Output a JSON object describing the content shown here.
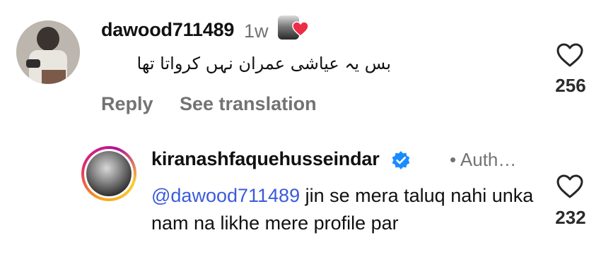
{
  "comment": {
    "username": "dawood711489",
    "time": "1w",
    "text": "بس یہ عیاشی عمران نہں کرواتا تھا",
    "reply_label": "Reply",
    "see_translation_label": "See translation",
    "like_count": "256",
    "avatar_icon": "profile-photo",
    "liked_by_author_icon": "heart-icon"
  },
  "reply": {
    "username": "kiranashfaquehusseindar",
    "verified": true,
    "author_label": "• Auth…",
    "mention": "@dawood711489",
    "text": " jin se mera taluq nahi unka nam na likhe mere profile par",
    "like_count": "232",
    "accent_color": "#3b5bdb"
  },
  "colors": {
    "like_heart_outline": "#262626",
    "liked_heart": "#ed2d45",
    "verified_badge": "#1a8cff",
    "muted_text": "#737373"
  }
}
